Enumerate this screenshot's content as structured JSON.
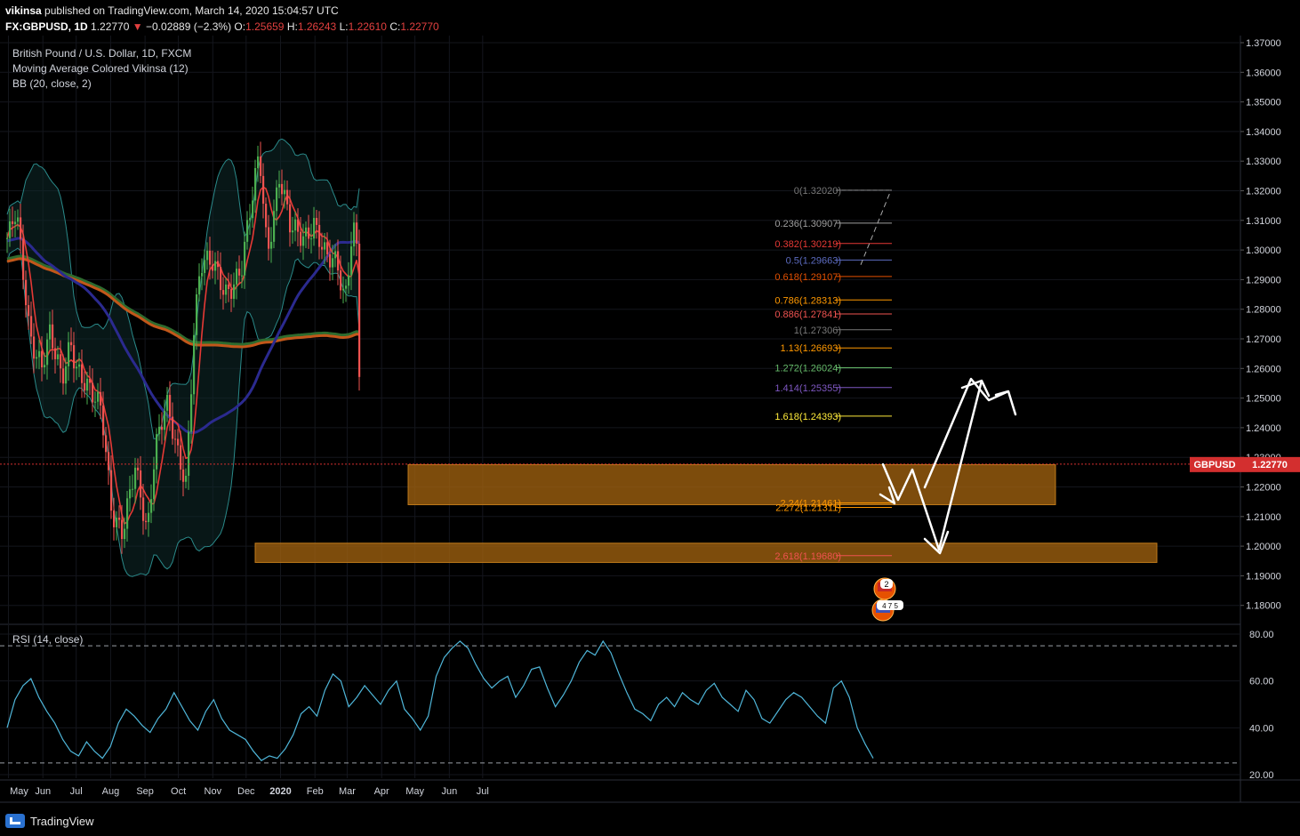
{
  "header": {
    "author": "vikinsa",
    "published_text": "published on TradingView.com, March 14, 2020 15:04:57 UTC",
    "symbol": "FX:GBPUSD, 1D",
    "last": "1.22770",
    "change": "−0.02889 (−2.3%)",
    "o_label": "O:",
    "o": "1.25659",
    "h_label": "H:",
    "h": "1.26243",
    "l_label": "L:",
    "l": "1.22610",
    "c_label": "C:",
    "c": "1.22770"
  },
  "legend": {
    "series_title": "British Pound / U.S. Dollar, 1D, FXCM",
    "ma_indicator": "Moving Average Colored Vikinsa (12)",
    "bb_indicator": "BB (20, close, 2)",
    "rsi_indicator": "RSI (14, close)"
  },
  "price_tag": {
    "symbol": "GBPUSD",
    "value": "1.22770",
    "color": "#d32f2f"
  },
  "footer": {
    "brand": "TradingView"
  },
  "colors": {
    "background": "#000000",
    "bull": "#4caf50",
    "bear": "#ef5350",
    "ma_red": "#e53935",
    "bb": "#2a8a8a",
    "ma_blue": "#2b2a8f",
    "ma_green": "#2e6b2e",
    "ma_orange": "#c2571a",
    "zone": "#a0620f",
    "rsi": "#4fb6d9"
  },
  "chart_data": [
    {
      "type": "candlestick",
      "title": "British Pound / U.S. Dollar, 1D, FXCM",
      "x_tick_labels": [
        "May",
        "Jun",
        "Jul",
        "Aug",
        "Sep",
        "Oct",
        "Nov",
        "Dec",
        "2020",
        "Feb",
        "Mar",
        "Apr",
        "May",
        "Jun",
        "Jul"
      ],
      "y_tick_labels": [
        "1.37000",
        "1.36000",
        "1.35000",
        "1.34000",
        "1.33000",
        "1.32000",
        "1.31000",
        "1.30000",
        "1.29000",
        "1.28000",
        "1.27000",
        "1.26000",
        "1.25000",
        "1.24000",
        "1.23000",
        "1.22000",
        "1.21000",
        "1.20000",
        "1.19000",
        "1.18000"
      ],
      "ylim": [
        1.175,
        1.372
      ],
      "grid": true,
      "close_path": [
        [
          "2019-05-01",
          1.304
        ],
        [
          "2019-05-08",
          1.312
        ],
        [
          "2019-05-20",
          1.272
        ],
        [
          "2019-05-31",
          1.262
        ],
        [
          "2019-06-07",
          1.271
        ],
        [
          "2019-06-18",
          1.255
        ],
        [
          "2019-06-26",
          1.27
        ],
        [
          "2019-07-01",
          1.262
        ],
        [
          "2019-07-15",
          1.25
        ],
        [
          "2019-07-24",
          1.245
        ],
        [
          "2019-08-02",
          1.213
        ],
        [
          "2019-08-12",
          1.205
        ],
        [
          "2019-08-23",
          1.225
        ],
        [
          "2019-09-03",
          1.205
        ],
        [
          "2019-09-10",
          1.235
        ],
        [
          "2019-09-20",
          1.248
        ],
        [
          "2019-09-30",
          1.23
        ],
        [
          "2019-10-08",
          1.222
        ],
        [
          "2019-10-15",
          1.275
        ],
        [
          "2019-10-21",
          1.296
        ],
        [
          "2019-11-01",
          1.294
        ],
        [
          "2019-11-12",
          1.286
        ],
        [
          "2019-11-27",
          1.294
        ],
        [
          "2019-12-06",
          1.315
        ],
        [
          "2019-12-13",
          1.333
        ],
        [
          "2019-12-20",
          1.3
        ],
        [
          "2019-12-31",
          1.325
        ],
        [
          "2020-01-10",
          1.306
        ],
        [
          "2020-01-22",
          1.305
        ],
        [
          "2020-01-31",
          1.31
        ],
        [
          "2020-02-11",
          1.296
        ],
        [
          "2020-02-21",
          1.295
        ],
        [
          "2020-02-28",
          1.284
        ],
        [
          "2020-03-06",
          1.31
        ],
        [
          "2020-03-10",
          1.3
        ],
        [
          "2020-03-12",
          1.257
        ],
        [
          "2020-03-13",
          1.2277
        ]
      ],
      "series": [
        {
          "name": "Moving Average Colored Vikinsa (12)",
          "color": "#e53935"
        },
        {
          "name": "BB (20, close, 2)",
          "color": "#2a8a8a"
        }
      ],
      "last_price": 1.2277,
      "fibonacci": [
        {
          "label": "0(1.32020)",
          "value": 1.3202,
          "color": "#777777"
        },
        {
          "label": "0.236(1.30907)",
          "value": 1.30907,
          "color": "#9e9e9e"
        },
        {
          "label": "0.382(1.30219)",
          "value": 1.30219,
          "color": "#e53935"
        },
        {
          "label": "0.5(1.29663)",
          "value": 1.29663,
          "color": "#5c6bc0"
        },
        {
          "label": "0.618(1.29107)",
          "value": 1.29107,
          "color": "#e65100"
        },
        {
          "label": "0.786(1.28313)",
          "value": 1.28313,
          "color": "#ff9800"
        },
        {
          "label": "0.886(1.27841)",
          "value": 1.27841,
          "color": "#ef5350"
        },
        {
          "label": "1(1.27306)",
          "value": 1.27306,
          "color": "#777777"
        },
        {
          "label": "1.13(1.26693)",
          "value": 1.26693,
          "color": "#ff9800"
        },
        {
          "label": "1.272(1.26024)",
          "value": 1.26024,
          "color": "#66bb6a"
        },
        {
          "label": "1.414(1.25355)",
          "value": 1.25355,
          "color": "#7e57c2"
        },
        {
          "label": "1.618(1.24393)",
          "value": 1.24393,
          "color": "#ffeb3b"
        },
        {
          "label": "2.24(1.21461)",
          "value": 1.21461,
          "color": "#ff9800"
        },
        {
          "label": "2.272(1.21311)",
          "value": 1.21311,
          "color": "#ff9800"
        },
        {
          "label": "2.618(1.19680)",
          "value": 1.1968,
          "color": "#ef5350"
        }
      ],
      "zones": [
        {
          "from": 1.214,
          "to": 1.2275
        },
        {
          "from": 1.1945,
          "to": 1.201
        }
      ]
    },
    {
      "type": "line",
      "title": "RSI (14, close)",
      "y_tick_labels": [
        "80.00",
        "60.00",
        "40.00",
        "20.00"
      ],
      "ylim": [
        20,
        80
      ],
      "guide_levels": [
        75,
        25
      ],
      "values": [
        40,
        52,
        58,
        61,
        53,
        47,
        42,
        35,
        30,
        28,
        34,
        30,
        27,
        32,
        42,
        48,
        45,
        41,
        38,
        44,
        48,
        55,
        49,
        43,
        39,
        47,
        52,
        44,
        39,
        37,
        35,
        30,
        26,
        28,
        27,
        31,
        37,
        46,
        49,
        45,
        56,
        63,
        60,
        49,
        53,
        58,
        54,
        50,
        56,
        60,
        48,
        44,
        39,
        45,
        62,
        70,
        74,
        77,
        74,
        67,
        61,
        57,
        60,
        62,
        53,
        58,
        65,
        66,
        57,
        49,
        54,
        60,
        68,
        73,
        71,
        77,
        72,
        63,
        55,
        48,
        46,
        43,
        50,
        53,
        49,
        55,
        52,
        50,
        56,
        59,
        53,
        50,
        47,
        56,
        52,
        44,
        42,
        47,
        52,
        55,
        53,
        49,
        45,
        42,
        57,
        60,
        53,
        40,
        33,
        27
      ]
    }
  ]
}
